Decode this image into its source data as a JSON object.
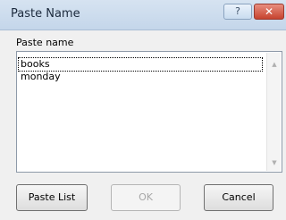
{
  "window": {
    "title": "Paste Name",
    "help_symbol": "?",
    "close_symbol": "✕"
  },
  "list": {
    "label": "Paste name",
    "items": [
      "books",
      "monday"
    ],
    "selected_item": "books"
  },
  "buttons": {
    "paste_list": "Paste List",
    "ok": "OK",
    "cancel": "Cancel"
  }
}
